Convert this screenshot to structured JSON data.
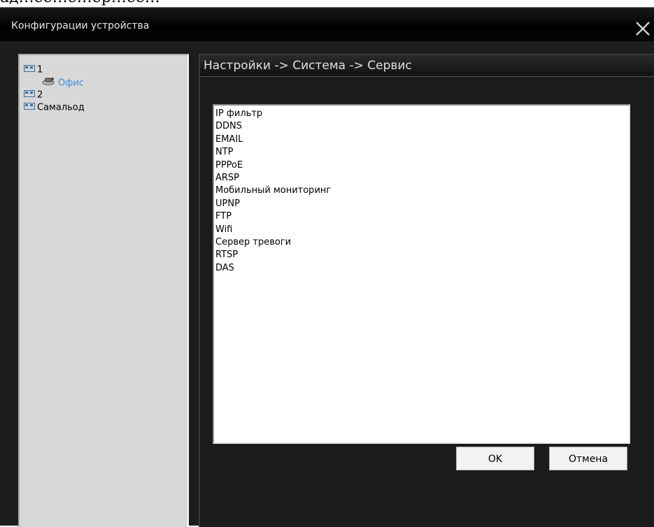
{
  "window": {
    "title": "Конфигурации устройства",
    "cut_text": "ад…ее…ё…ер…ее…"
  },
  "tree": [
    {
      "label": "1",
      "icon": "camera-group-icon"
    },
    {
      "label": "Офис",
      "icon": "camera-device-icon"
    },
    {
      "label": "2",
      "icon": "camera-group-icon"
    },
    {
      "label": "Самальод",
      "icon": "camera-group-icon"
    }
  ],
  "panel": {
    "breadcrumb": "Настройки -> Система -> Сервис"
  },
  "services": [
    "IP фильтр",
    "DDNS",
    "EMAIL",
    "NTP",
    "PPPoE",
    "ARSP",
    "Мобильный мониторинг",
    "UPNP",
    "FTP",
    "Wifi",
    "Сервер тревоги",
    "RTSP",
    "DAS"
  ],
  "buttons": {
    "ok": "OK",
    "cancel": "Отмена"
  },
  "colors": {
    "selected_node": "#3a8ee6",
    "window_bg": "#1d1d1d"
  }
}
